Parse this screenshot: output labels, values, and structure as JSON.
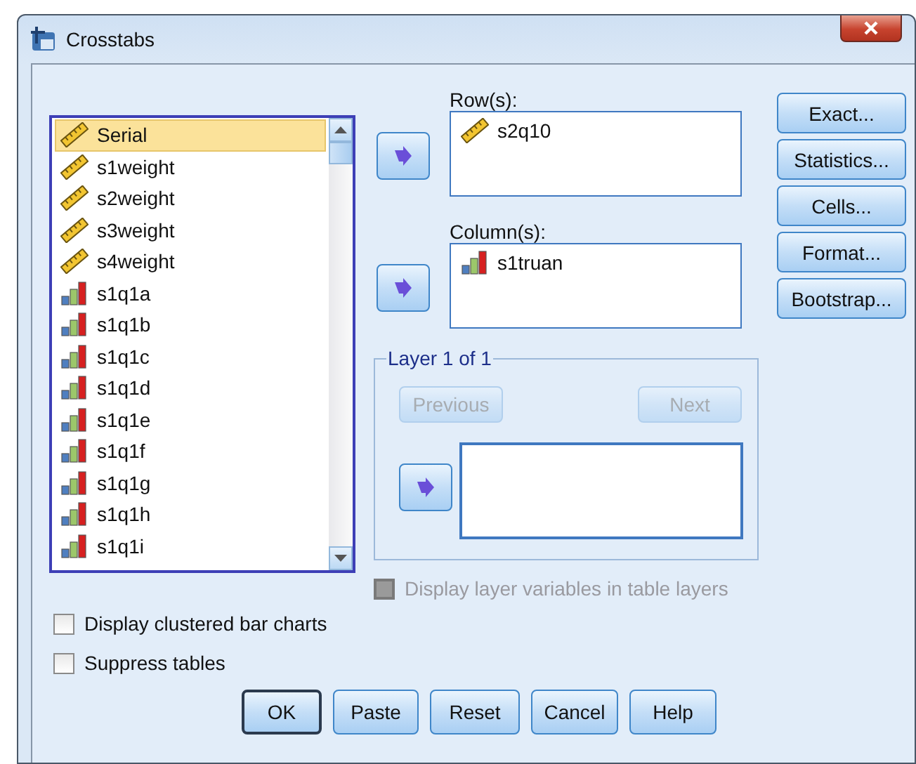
{
  "window": {
    "title": "Crosstabs"
  },
  "variables": [
    {
      "name": "Serial",
      "kind": "scale",
      "selected": true
    },
    {
      "name": "s1weight",
      "kind": "scale",
      "selected": false
    },
    {
      "name": "s2weight",
      "kind": "scale",
      "selected": false
    },
    {
      "name": "s3weight",
      "kind": "scale",
      "selected": false
    },
    {
      "name": "s4weight",
      "kind": "scale",
      "selected": false
    },
    {
      "name": "s1q1a",
      "kind": "nominal",
      "selected": false
    },
    {
      "name": "s1q1b",
      "kind": "nominal",
      "selected": false
    },
    {
      "name": "s1q1c",
      "kind": "nominal",
      "selected": false
    },
    {
      "name": "s1q1d",
      "kind": "nominal",
      "selected": false
    },
    {
      "name": "s1q1e",
      "kind": "nominal",
      "selected": false
    },
    {
      "name": "s1q1f",
      "kind": "nominal",
      "selected": false
    },
    {
      "name": "s1q1g",
      "kind": "nominal",
      "selected": false
    },
    {
      "name": "s1q1h",
      "kind": "nominal",
      "selected": false
    },
    {
      "name": "s1q1i",
      "kind": "nominal",
      "selected": false
    }
  ],
  "rows_box": {
    "label": "Row(s):",
    "items": [
      {
        "name": "s2q10",
        "kind": "scale"
      }
    ]
  },
  "columns_box": {
    "label": "Column(s):",
    "items": [
      {
        "name": "s1truan",
        "kind": "nominal"
      }
    ]
  },
  "side_buttons": [
    "Exact...",
    "Statistics...",
    "Cells...",
    "Format...",
    "Bootstrap..."
  ],
  "layer": {
    "title": "Layer 1 of 1",
    "previous": {
      "label": "Previous",
      "disabled": true
    },
    "next": {
      "label": "Next",
      "disabled": true
    }
  },
  "layer_option": {
    "label": "Display layer variables in table layers",
    "checked": false,
    "disabled": true
  },
  "options": [
    {
      "label": "Display clustered bar charts",
      "checked": false
    },
    {
      "label": "Suppress tables",
      "checked": false
    }
  ],
  "buttons": [
    {
      "label": "OK",
      "default": true
    },
    {
      "label": "Paste",
      "default": false
    },
    {
      "label": "Reset",
      "default": false
    },
    {
      "label": "Cancel",
      "default": false
    },
    {
      "label": "Help",
      "default": false
    }
  ]
}
